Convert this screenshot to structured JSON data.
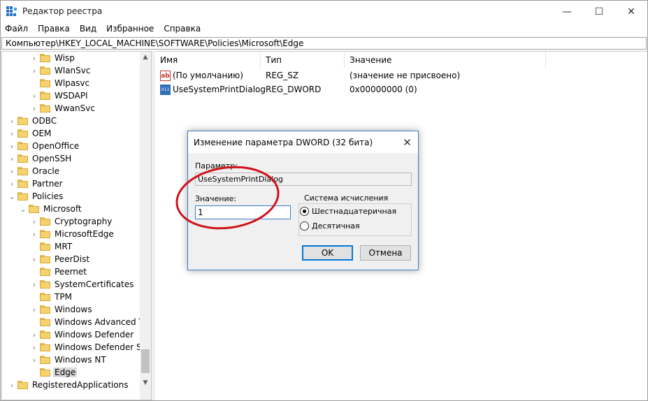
{
  "window": {
    "title": "Редактор реестра",
    "controls": {
      "minimize": "—",
      "maximize": "☐",
      "close": "✕"
    }
  },
  "menu": [
    "Файл",
    "Правка",
    "Вид",
    "Избранное",
    "Справка"
  ],
  "address": "Компьютер\\HKEY_LOCAL_MACHINE\\SOFTWARE\\Policies\\Microsoft\\Edge",
  "tree": [
    {
      "label": "Wisp",
      "level": 2,
      "expander": "collapsed"
    },
    {
      "label": "WlanSvc",
      "level": 2,
      "expander": "collapsed"
    },
    {
      "label": "Wlpasvc",
      "level": 2,
      "expander": "none"
    },
    {
      "label": "WSDAPI",
      "level": 2,
      "expander": "collapsed"
    },
    {
      "label": "WwanSvc",
      "level": 2,
      "expander": "collapsed"
    },
    {
      "label": "ODBC",
      "level": 0,
      "expander": "collapsed"
    },
    {
      "label": "OEM",
      "level": 0,
      "expander": "collapsed"
    },
    {
      "label": "OpenOffice",
      "level": 0,
      "expander": "collapsed"
    },
    {
      "label": "OpenSSH",
      "level": 0,
      "expander": "collapsed"
    },
    {
      "label": "Oracle",
      "level": 0,
      "expander": "collapsed"
    },
    {
      "label": "Partner",
      "level": 0,
      "expander": "collapsed"
    },
    {
      "label": "Policies",
      "level": 0,
      "expander": "expanded"
    },
    {
      "label": "Microsoft",
      "level": 1,
      "expander": "expanded"
    },
    {
      "label": "Cryptography",
      "level": 2,
      "expander": "collapsed"
    },
    {
      "label": "MicrosoftEdge",
      "level": 2,
      "expander": "collapsed"
    },
    {
      "label": "MRT",
      "level": 2,
      "expander": "none"
    },
    {
      "label": "PeerDist",
      "level": 2,
      "expander": "collapsed"
    },
    {
      "label": "Peernet",
      "level": 2,
      "expander": "none"
    },
    {
      "label": "SystemCertificates",
      "level": 2,
      "expander": "collapsed"
    },
    {
      "label": "TPM",
      "level": 2,
      "expander": "none"
    },
    {
      "label": "Windows",
      "level": 2,
      "expander": "collapsed"
    },
    {
      "label": "Windows Advanced Thr",
      "level": 2,
      "expander": "none"
    },
    {
      "label": "Windows Defender",
      "level": 2,
      "expander": "collapsed"
    },
    {
      "label": "Windows Defender Secu",
      "level": 2,
      "expander": "collapsed"
    },
    {
      "label": "Windows NT",
      "level": 2,
      "expander": "collapsed"
    },
    {
      "label": "Edge",
      "level": 2,
      "expander": "none",
      "selected": true
    },
    {
      "label": "RegisteredApplications",
      "level": 0,
      "expander": "collapsed"
    }
  ],
  "list": {
    "columns": [
      "Имя",
      "Тип",
      "Значение"
    ],
    "rows": [
      {
        "icon": "string-value-icon",
        "icon_text": "ab",
        "name": "(По умолчанию)",
        "type": "REG_SZ",
        "value": "(значение не присвоено)"
      },
      {
        "icon": "binary-value-icon",
        "icon_text": "011",
        "name": "UseSystemPrintDialog",
        "type": "REG_DWORD",
        "value": "0x00000000 (0)"
      }
    ]
  },
  "dialog": {
    "title": "Изменение параметра DWORD (32 бита)",
    "param_label": "Параметр:",
    "param_value": "UseSystemPrintDialog",
    "value_label": "Значение:",
    "value": "1",
    "base_group": "Система исчисления",
    "base_hex": "Шестнадцатеричная",
    "base_dec": "Десятичная",
    "selected_base": "hex",
    "ok": "OK",
    "cancel": "Отмена",
    "close": "✕"
  },
  "colors": {
    "annotation": "#d0121b",
    "accent": "#0078d7",
    "folder": "#f6d26f"
  }
}
